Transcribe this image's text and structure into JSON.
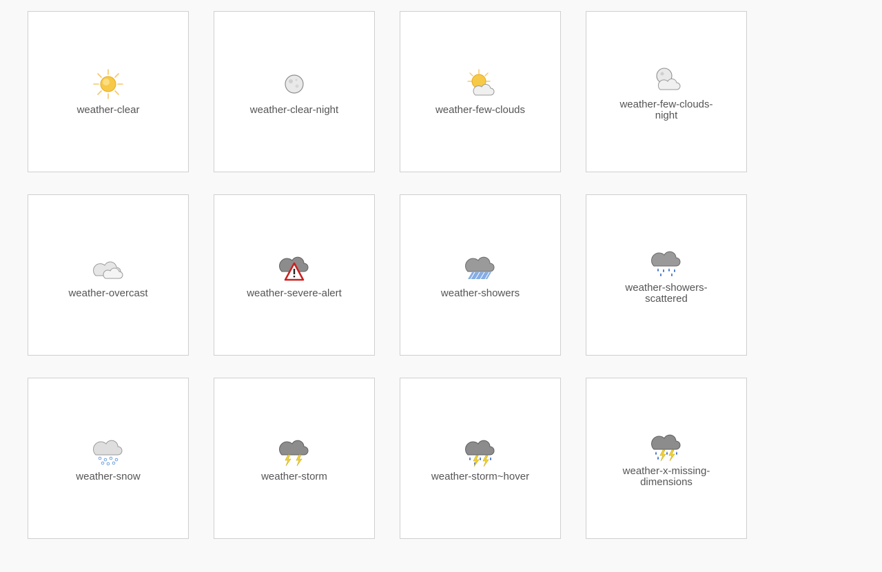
{
  "tiles": [
    {
      "label": "weather-clear",
      "icon": "weather-clear-icon"
    },
    {
      "label": "weather-clear-night",
      "icon": "weather-clear-night-icon"
    },
    {
      "label": "weather-few-clouds",
      "icon": "weather-few-clouds-icon"
    },
    {
      "label": "weather-few-clouds-night",
      "icon": "weather-few-clouds-night-icon"
    },
    {
      "label": "weather-overcast",
      "icon": "weather-overcast-icon"
    },
    {
      "label": "weather-severe-alert",
      "icon": "weather-severe-alert-icon"
    },
    {
      "label": "weather-showers",
      "icon": "weather-showers-icon"
    },
    {
      "label": "weather-showers-scattered",
      "icon": "weather-showers-scattered-icon"
    },
    {
      "label": "weather-snow",
      "icon": "weather-snow-icon"
    },
    {
      "label": "weather-storm",
      "icon": "weather-storm-icon"
    },
    {
      "label": "weather-storm~hover",
      "icon": "weather-storm-hover-icon"
    },
    {
      "label": "weather-x-missing-dimensions",
      "icon": "weather-x-missing-dimensions-icon"
    }
  ],
  "colors": {
    "page_background": "#f9f9f9",
    "tile_background": "#ffffff",
    "tile_border": "#cfcfcf",
    "label_text": "#555555",
    "sun": "#f7c948",
    "cloud_light": "#e8e8e8",
    "cloud_dark": "#8c8c8c",
    "rain": "#3a6fc4",
    "lightning": "#f2d43a",
    "alert_red": "#cc1f1f"
  }
}
